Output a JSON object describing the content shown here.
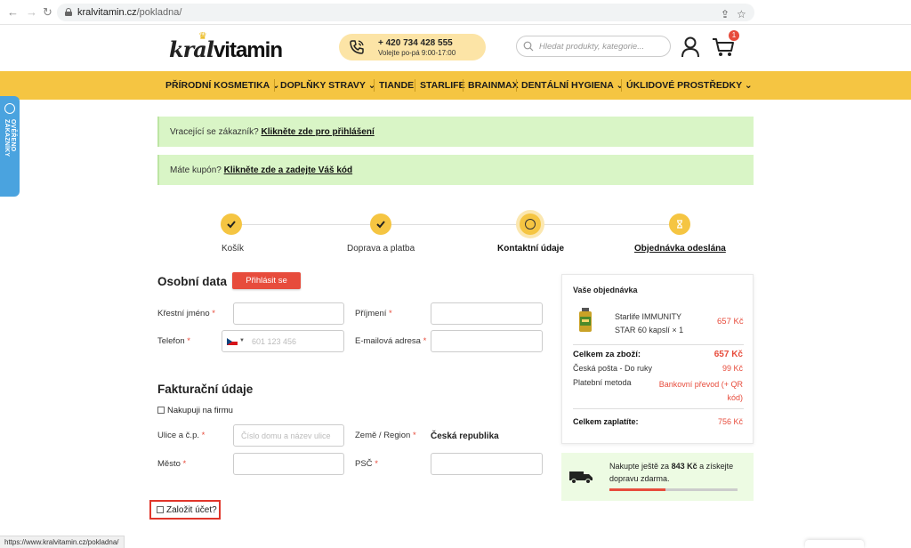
{
  "browser": {
    "url_domain": "kralvitamin.cz",
    "url_path": "/pokladna/",
    "status_url": "https://www.kralvitamin.cz/pokladna/"
  },
  "header": {
    "logo_text_a": "kral",
    "logo_text_b": "vitamin",
    "phone": "+ 420 734 428 555",
    "hours": "Volejte po-pá 9:00-17:00",
    "search_placeholder": "Hledat produkty, kategorie...",
    "cart_count": "1"
  },
  "nav": [
    {
      "label": "PŘÍRODNÍ KOSMETIKA",
      "dropdown": true
    },
    {
      "label": "DOPLŇKY STRAVY",
      "dropdown": true
    },
    {
      "label": "TIANDE",
      "dropdown": false
    },
    {
      "label": "STARLIFE",
      "dropdown": false
    },
    {
      "label": "BRAINMAX",
      "dropdown": false
    },
    {
      "label": "DENTÁLNÍ HYGIENA",
      "dropdown": true
    },
    {
      "label": "ÚKLIDOVÉ PROSTŘEDKY",
      "dropdown": true
    }
  ],
  "side_tab": "OVĚŘENO ZÁKAZNÍKY",
  "notices": {
    "returning_prefix": "Vracející se zákazník?",
    "returning_link": "Klikněte zde pro přihlášení",
    "coupon_prefix": "Máte kupón?",
    "coupon_link": "Klikněte zde a zadejte Váš kód"
  },
  "steps": [
    {
      "label": "Košík",
      "state": "done"
    },
    {
      "label": "Doprava a platba",
      "state": "done"
    },
    {
      "label": "Kontaktní údaje",
      "state": "active"
    },
    {
      "label": "Objednávka odeslána",
      "state": "pending"
    }
  ],
  "personal": {
    "title": "Osobní data",
    "login_button": "Přihlásit se",
    "first_name_label": "Křestní jméno",
    "last_name_label": "Příjmení",
    "phone_label": "Telefon",
    "phone_placeholder": "601 123 456",
    "email_label": "E-mailová adresa",
    "required_mark": "*"
  },
  "billing": {
    "title": "Fakturační údaje",
    "company_checkbox": "Nakupuji na firmu",
    "street_label": "Ulice a č.p.",
    "street_placeholder": "Číslo domu a název ulice",
    "country_label": "Země / Region",
    "country_value": "Česká republika",
    "city_label": "Město",
    "zip_label": "PSČ",
    "create_account": "Založit účet?"
  },
  "summary": {
    "title": "Vaše objednávka",
    "product_name": "Starlife IMMUNITY STAR 60 kapslí × 1",
    "product_price": "657 Kč",
    "subtotal_label": "Celkem za zboží:",
    "subtotal_value": "657 Kč",
    "shipping_label": "Česká pošta - Do ruky",
    "shipping_value": "99 Kč",
    "payment_label": "Platební metoda",
    "payment_value": "Bankovní převod (+ QR kód)",
    "total_label": "Celkem zaplatíte:",
    "total_value": "756 Kč"
  },
  "free_shipping": {
    "prefix": "Nakupte ještě za",
    "amount": "843 Kč",
    "suffix": "a získejte dopravu zdarma.",
    "progress": 0.44
  },
  "colors": {
    "accent_yellow": "#f5c542",
    "red": "#e74c3c",
    "notice_green": "#d9f5c6",
    "side_tab_blue": "#4aa3df"
  }
}
